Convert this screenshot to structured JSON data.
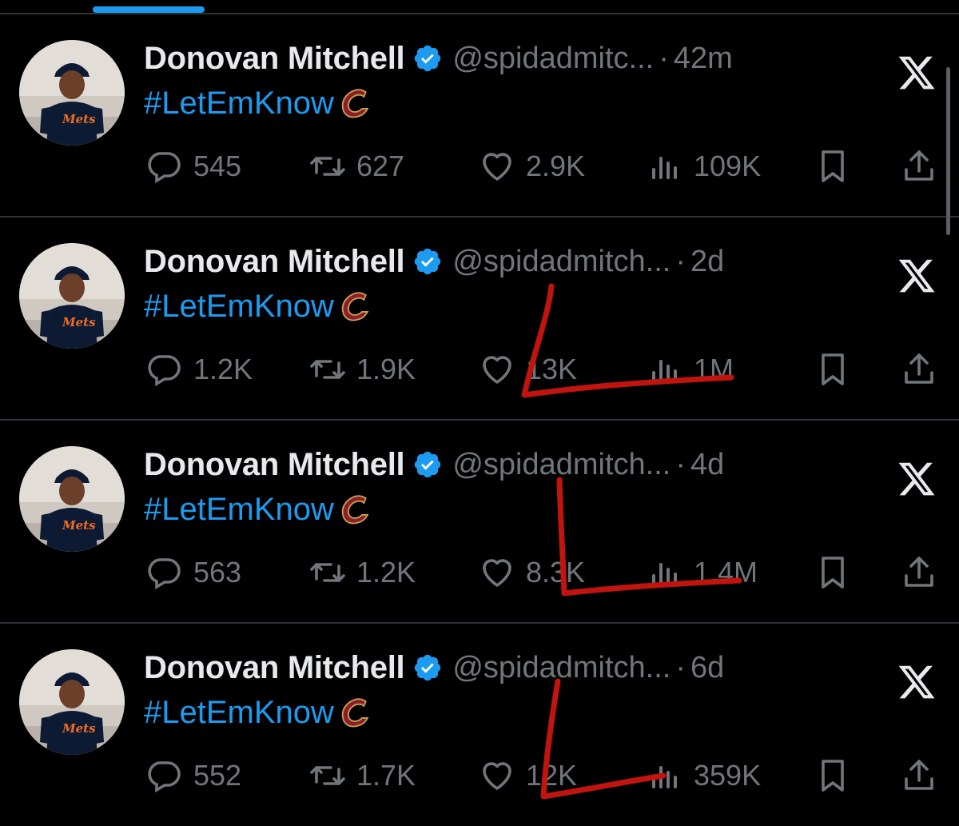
{
  "colors": {
    "background": "#000000",
    "divider": "#2f3336",
    "text_primary": "#e7e9ea",
    "text_secondary": "#71767b",
    "accent": "#1d9bf0",
    "annotation": "#c0150f"
  },
  "icons": {
    "verified": "verified-badge-icon",
    "x": "x-logo-icon",
    "reply": "reply-icon",
    "retweet": "retweet-icon",
    "like": "heart-icon",
    "views": "views-chart-icon",
    "bookmark": "bookmark-icon",
    "share": "share-icon",
    "team": "cavaliers-logo-icon"
  },
  "tweets": [
    {
      "name": "Donovan Mitchell",
      "handle": "@spidadmitc...",
      "separator": "·",
      "time": "42m",
      "text": "#LetEmKnow",
      "replies": "545",
      "retweets": "627",
      "likes": "2.9K",
      "views": "109K"
    },
    {
      "name": "Donovan Mitchell",
      "handle": "@spidadmitch...",
      "separator": "·",
      "time": "2d",
      "text": "#LetEmKnow",
      "replies": "1.2K",
      "retweets": "1.9K",
      "likes": "13K",
      "views": "1M"
    },
    {
      "name": "Donovan Mitchell",
      "handle": "@spidadmitch...",
      "separator": "·",
      "time": "4d",
      "text": "#LetEmKnow",
      "replies": "563",
      "retweets": "1.2K",
      "likes": "8.3K",
      "views": "1.4M"
    },
    {
      "name": "Donovan Mitchell",
      "handle": "@spidadmitch...",
      "separator": "·",
      "time": "6d",
      "text": "#LetEmKnow",
      "replies": "552",
      "retweets": "1.7K",
      "likes": "12K",
      "views": "359K"
    }
  ],
  "annotations": [
    {
      "shape": "L",
      "description": "hand-drawn red L mark over likes and views"
    },
    {
      "shape": "L",
      "description": "hand-drawn red L mark over likes and views"
    },
    {
      "shape": "L",
      "description": "hand-drawn red L mark over likes and views"
    }
  ]
}
